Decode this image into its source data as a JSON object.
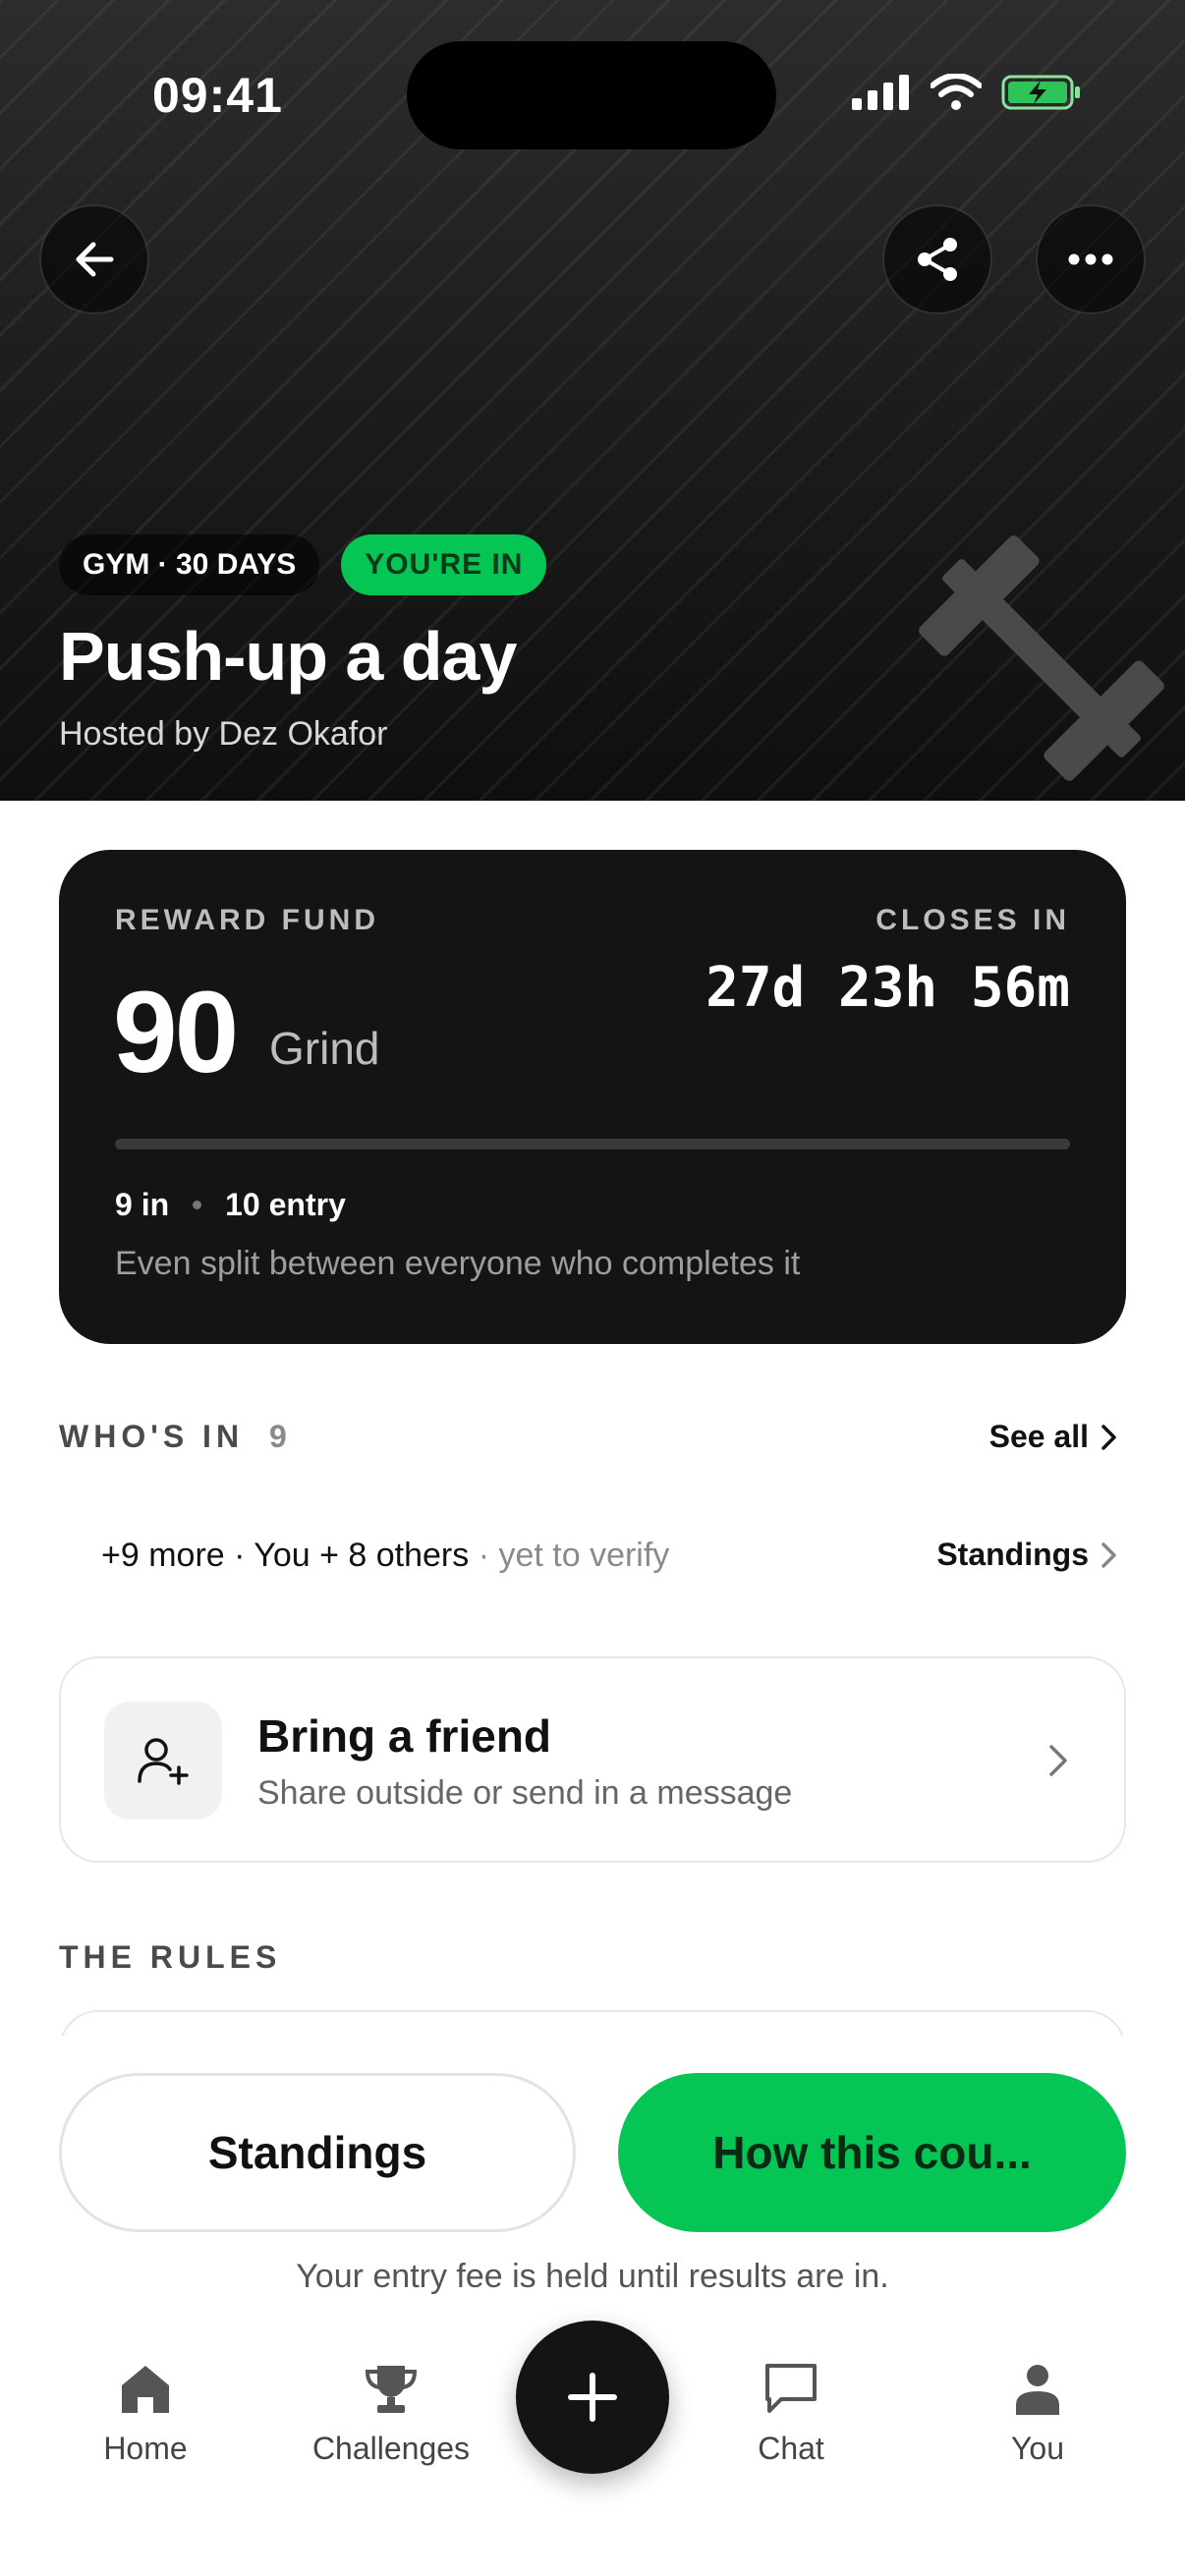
{
  "status_bar": {
    "time": "09:41"
  },
  "hero": {
    "category": "GYM · 30 DAYS",
    "badge": "YOU'RE IN",
    "title": "Push-up a day",
    "host": "Hosted by Dez Okafor"
  },
  "reward": {
    "label": "REWARD FUND",
    "amount": "90",
    "unit": "Grind",
    "closes_label": "CLOSES IN",
    "countdown": "27d 23h 56m",
    "participants": "9 in",
    "entry": "10 entry",
    "progress_fraction": 0.0,
    "split_note": "Even split between everyone who completes it"
  },
  "whos_in": {
    "heading": "WHO'S IN",
    "count": "9",
    "see_all": "See all",
    "summary": "+9 more · You + 8 others",
    "summary_muted": " · yet to verify",
    "standings_link": "Standings"
  },
  "invite": {
    "title": "Bring a friend",
    "subtitle": "Share outside or send in a message"
  },
  "rules": {
    "heading": "THE RULES"
  },
  "actions": {
    "standings_button": "Standings",
    "primary_button": "How this cou...",
    "fee_note": "Your entry fee is held until results are in."
  },
  "tab_bar": {
    "home": "Home",
    "challenges": "Challenges",
    "chat": "Chat",
    "you": "You"
  },
  "colors": {
    "accent": "#05c654",
    "dark": "#141414"
  },
  "icons": [
    "back-arrow-icon",
    "share-icon",
    "more-icon",
    "barbell-icon",
    "add-user-icon",
    "chevron-right-icon",
    "home-icon",
    "trophy-icon",
    "plus-icon",
    "chat-icon",
    "person-icon"
  ]
}
